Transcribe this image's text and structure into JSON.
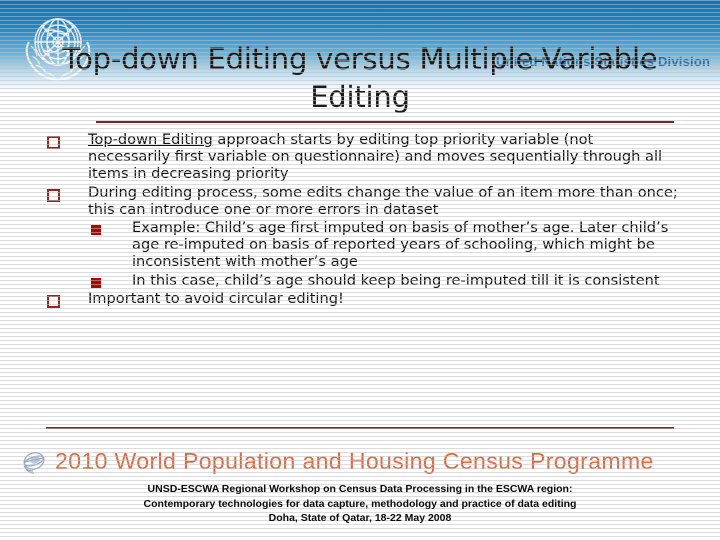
{
  "header": {
    "org_name": "United Nations Statistics Division",
    "logo_icon": "un-emblem-icon"
  },
  "title": "Top-down Editing versus Multiple-Variable Editing",
  "content": {
    "bullets": [
      {
        "level": 1,
        "marker": "hollow-square-bullet",
        "underlined_term": "Top-down Editing",
        "rest": " approach starts by editing top priority variable (not necessarily first variable on questionnaire) and moves sequentially through all items in decreasing priority"
      },
      {
        "level": 1,
        "marker": "hollow-square-bullet",
        "text": "During editing process, some edits change the value of an item more than once; this can introduce one or more errors in dataset"
      },
      {
        "level": 2,
        "marker": "filled-square-bullet",
        "text": "Example: Child’s age first imputed on basis of mother’s age. Later child’s age re-imputed on basis of reported years of schooling, which might be inconsistent with mother’s age"
      },
      {
        "level": 2,
        "marker": "filled-square-bullet",
        "text": "In this case, child’s age should keep being re-imputed till it is consistent"
      },
      {
        "level": 1,
        "marker": "hollow-square-bullet",
        "text": "Important to avoid circular editing!"
      }
    ]
  },
  "banner": {
    "icon": "globe-icon",
    "text": "2010 World Population and Housing Census Programme"
  },
  "footer": {
    "line1": "UNSD-ESCWA Regional Workshop on Census Data Processing in the ESCWA region:",
    "line2": "Contemporary technologies for data capture, methodology and practice of data editing",
    "line3": "Doha, State of Qatar, 18-22 May 2008"
  },
  "colors": {
    "header_blue": "#0a76bf",
    "rule_maroon": "#7b2222",
    "bullet_red": "#b00505",
    "banner_orange": "#e2663e",
    "org_text_blue": "#2d6fa8"
  }
}
